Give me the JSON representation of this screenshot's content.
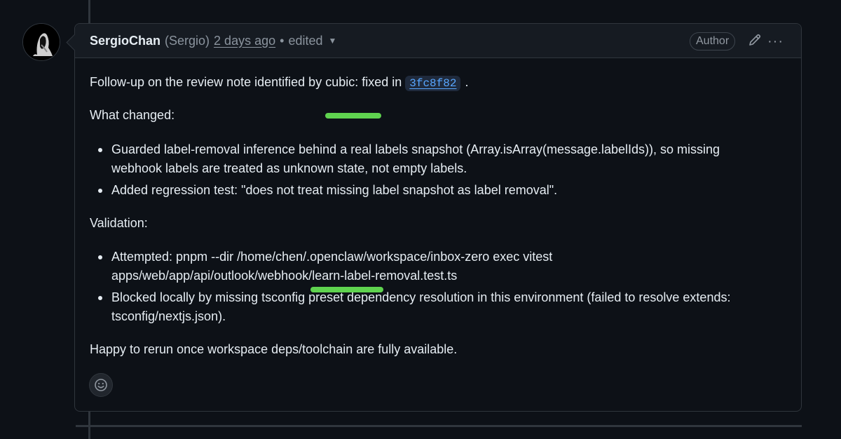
{
  "comment": {
    "author": "SergioChan",
    "author_full_name": "(Sergio)",
    "timestamp": "2 days ago",
    "separator": "•",
    "edited_label": "edited",
    "badge": "Author",
    "actions_label": "···",
    "caret": "▼"
  },
  "body": {
    "intro_text": "Follow-up on the review note identified by cubic: fixed in ",
    "commit_hash": "3fc8f82",
    "intro_end": ".",
    "what_changed_heading": "What changed:",
    "changes": [
      "Guarded label-removal inference behind a real labels snapshot (Array.isArray(message.labelIds)), so missing",
      "webhook labels are treated as unknown state, not empty labels.",
      "Added regression test: \"does not treat missing label snapshot as label removal\"."
    ],
    "validation_heading": "Validation:",
    "validation": [
      "Attempted: pnpm --dir /home/chen/.openclaw/workspace/inbox-zero exec vitest",
      "apps/web/app/api/outlook/webhook/learn-label-removal.test.ts",
      "Blocked locally by missing tsconfig preset dependency resolution in this environment (failed to resolve extends:",
      "tsconfig/nextjs.json)."
    ],
    "closing": "Happy to rerun once workspace deps/toolchain are fully available."
  },
  "colors": {
    "highlight": "#5fd34f",
    "link": "#58a6ff"
  }
}
